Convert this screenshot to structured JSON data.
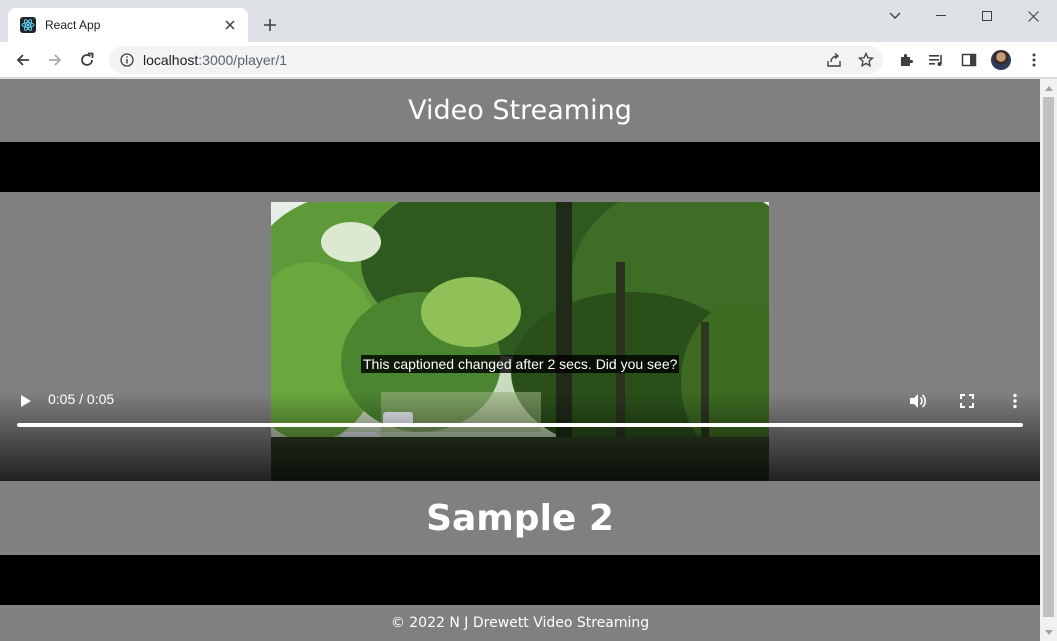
{
  "browser": {
    "tab_title": "React App",
    "url_host": "localhost",
    "url_rest": ":3000/player/1"
  },
  "page": {
    "header_title": "Video Streaming",
    "video": {
      "caption": "This captioned changed after 2 secs. Did you see?",
      "time_display": "0:05 / 0:05",
      "progress": 1.0
    },
    "sample_title": "Sample 2",
    "footer": "© 2022 N J Drewett Video Streaming"
  },
  "colors": {
    "page_bg": "#808080",
    "band": "#000000",
    "chrome_bg": "#dee1e6"
  }
}
